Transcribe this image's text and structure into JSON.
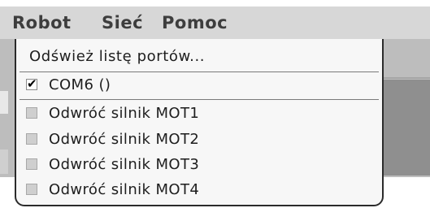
{
  "menubar": {
    "items": [
      {
        "label": "Robot"
      },
      {
        "label": "Sieć"
      },
      {
        "label": "Pomoc"
      }
    ]
  },
  "dropdown": {
    "refresh_label": "Odśwież listę portów...",
    "port": {
      "label": "COM6 ()",
      "checked": true
    },
    "motor_options": [
      {
        "label": "Odwróć silnik MOT1",
        "checked": false
      },
      {
        "label": "Odwróć silnik MOT2",
        "checked": false
      },
      {
        "label": "Odwróć silnik MOT3",
        "checked": false
      },
      {
        "label": "Odwróć silnik MOT4",
        "checked": false
      }
    ]
  },
  "colors": {
    "menubar_bg": "#d7d7d7",
    "menu_text": "#3d3d3d",
    "dropdown_bg": "#f7f7f7",
    "dropdown_border": "#2b2b2b"
  }
}
